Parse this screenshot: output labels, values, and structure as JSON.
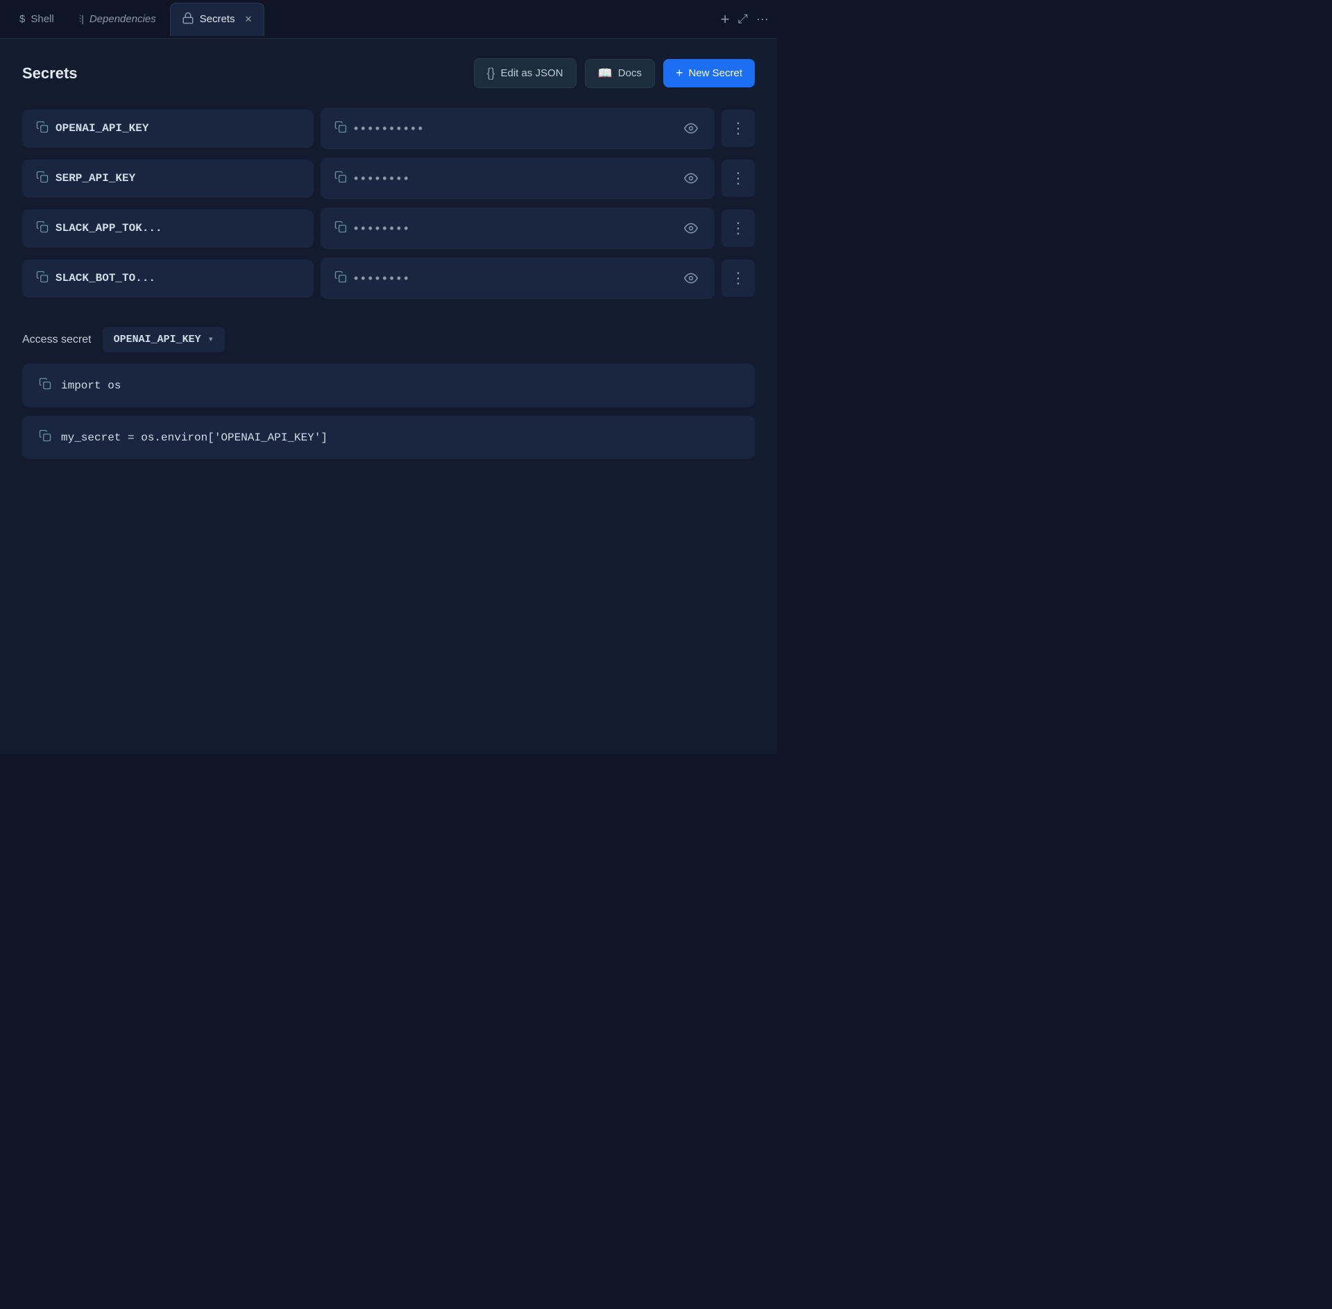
{
  "tabs": [
    {
      "id": "shell",
      "label": "Shell",
      "icon": "terminal",
      "active": false,
      "closeable": false
    },
    {
      "id": "dependencies",
      "label": "Dependencies",
      "icon": "deps",
      "active": false,
      "closeable": false
    },
    {
      "id": "secrets",
      "label": "Secrets",
      "icon": "lock",
      "active": true,
      "closeable": true
    }
  ],
  "tab_actions": {
    "add": "+",
    "expand": "⤢",
    "more": "···"
  },
  "page": {
    "title": "Secrets",
    "edit_json_label": "Edit as JSON",
    "docs_label": "Docs",
    "new_secret_label": "New Secret"
  },
  "secrets": [
    {
      "name": "OPENAI_API_KEY",
      "value_dots": "••••••••••"
    },
    {
      "name": "SERP_API_KEY",
      "value_dots": "••••••••"
    },
    {
      "name": "SLACK_APP_TOK...",
      "value_dots": "••••••••"
    },
    {
      "name": "SLACK_BOT_TO...",
      "value_dots": "••••••••"
    }
  ],
  "access_section": {
    "label": "Access secret",
    "selected_secret": "OPENAI_API_KEY",
    "code_lines": [
      "import os",
      "my_secret = os.environ['OPENAI_API_KEY']"
    ]
  }
}
